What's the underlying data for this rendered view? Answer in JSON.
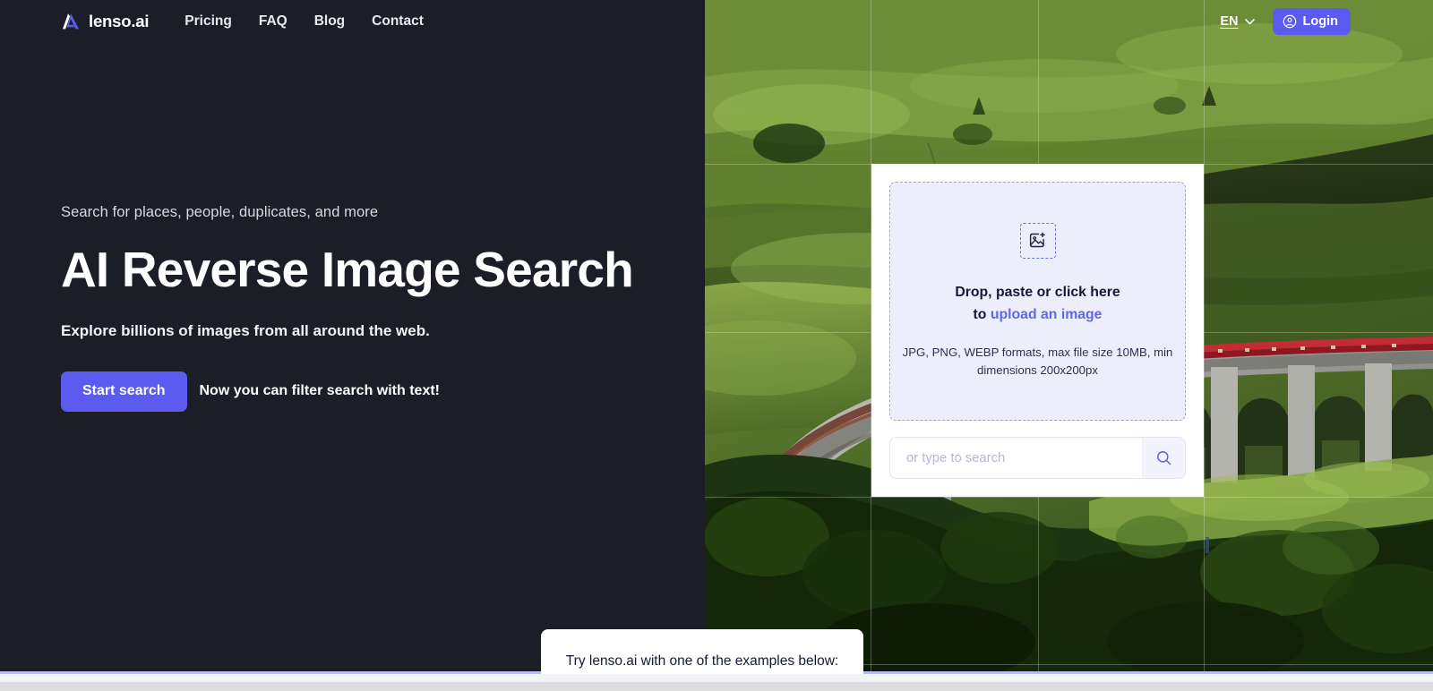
{
  "header": {
    "brand": {
      "name": "lenso.ai",
      "logo_icon": "lenso-a-mark-icon"
    },
    "nav": [
      {
        "label": "Pricing"
      },
      {
        "label": "FAQ"
      },
      {
        "label": "Blog"
      },
      {
        "label": "Contact"
      }
    ],
    "language": {
      "code": "EN",
      "chevron_icon": "chevron-down-icon"
    },
    "login": {
      "label": "Login",
      "icon": "user-circle-icon"
    }
  },
  "hero": {
    "eyebrow": "Search for places, people, duplicates, and more",
    "title": "AI Reverse Image Search",
    "lede": "Explore billions of images from all around the web.",
    "cta_button": "Start search",
    "cta_note": "Now you can filter search with text!"
  },
  "upload": {
    "dropzone_icon": "image-add-icon",
    "prompt_main": "Drop, paste or click here",
    "prompt_to": "to",
    "prompt_link": "upload an image",
    "constraints": "JPG, PNG, WEBP formats, max file size 10MB, min dimensions 200x200px",
    "search_placeholder": "or type to search",
    "search_value": "",
    "search_icon": "search-icon"
  },
  "examples": {
    "text": "Try lenso.ai with one of the examples below:"
  },
  "background": {
    "description": "Aerial photo of a curved stone railway viaduct with a red train crossing green hills",
    "grid_overlay": true
  },
  "colors": {
    "accent": "#5b5bef",
    "hero_dark": "#1b1e26",
    "dropzone_bg": "#eceefc",
    "dropzone_border": "#9aa2e8",
    "link": "#6168e8",
    "text_dark": "#141a35"
  }
}
